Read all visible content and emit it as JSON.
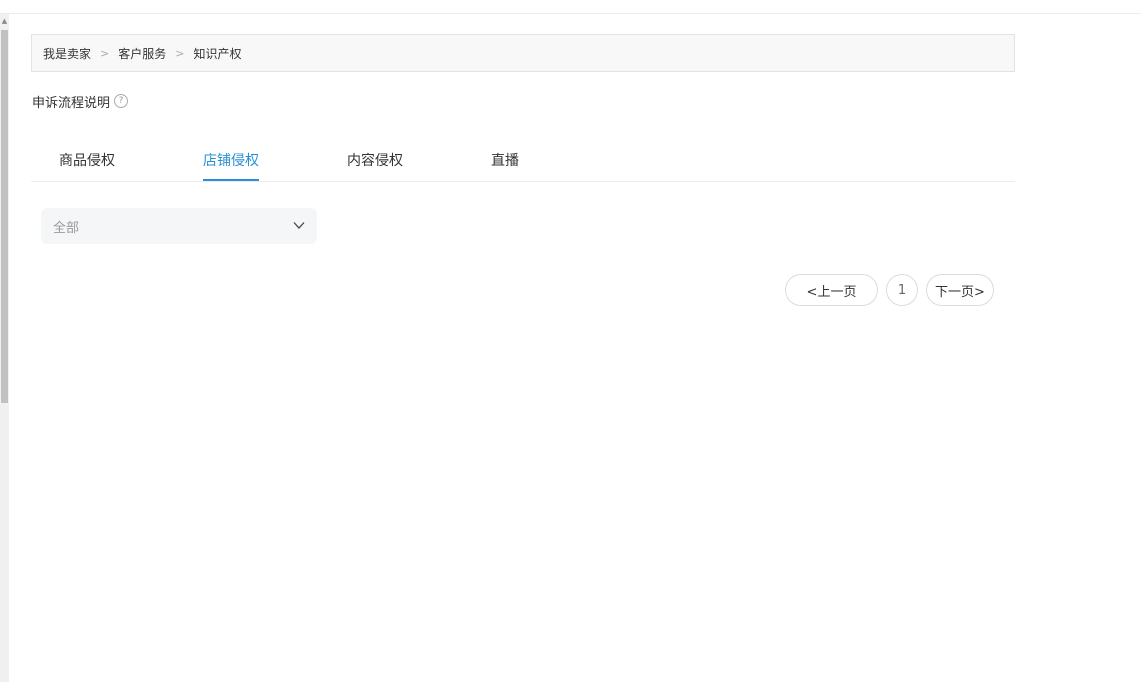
{
  "breadcrumb": {
    "items": [
      "我是卖家",
      "客户服务",
      "知识产权"
    ],
    "separator": ">"
  },
  "appeal": {
    "label": "申诉流程说明",
    "help_icon": "?"
  },
  "tabs": [
    {
      "label": "商品侵权",
      "active": false
    },
    {
      "label": "店铺侵权",
      "active": true
    },
    {
      "label": "内容侵权",
      "active": false
    },
    {
      "label": "直播",
      "active": false
    }
  ],
  "filter": {
    "selected": "全部",
    "icon": "chevron-down-icon"
  },
  "pagination": {
    "prev_label": "<上一页",
    "current_page": "1",
    "next_label": "下一页>"
  },
  "colors": {
    "accent": "#2a8fd6",
    "breadcrumb_bg": "#f8f8f8",
    "select_bg": "#f5f6f8"
  }
}
